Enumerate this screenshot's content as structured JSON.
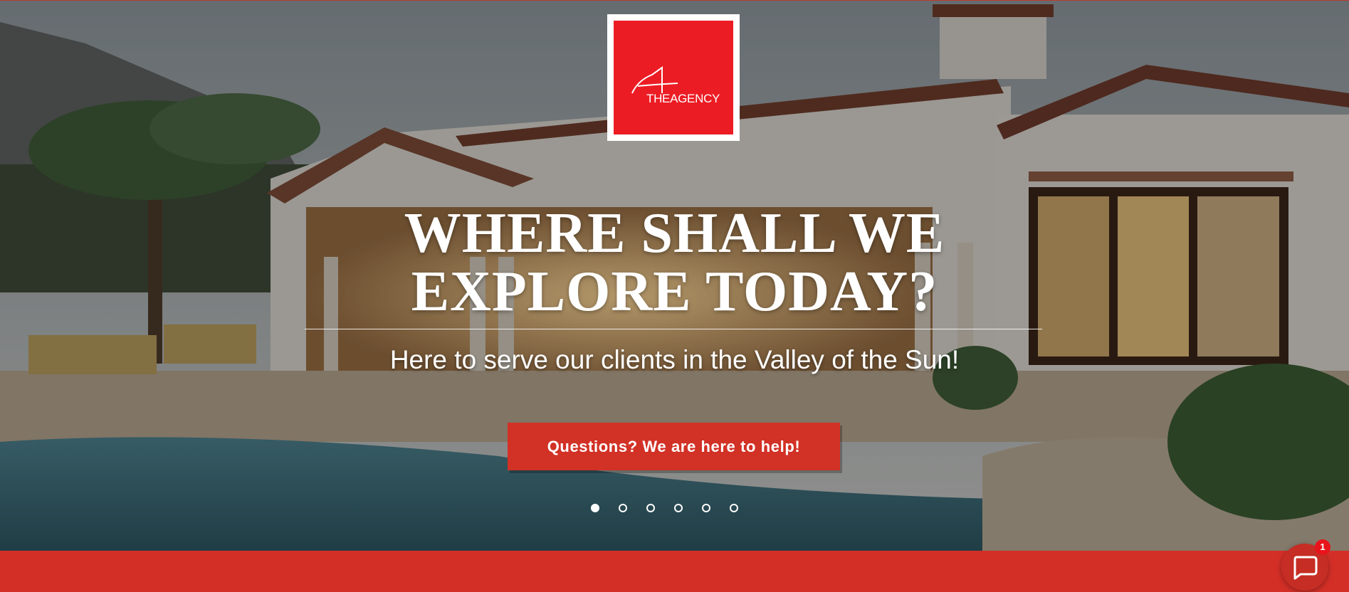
{
  "logo": {
    "text": "THEAGENCY",
    "brand_color": "#ec1c24"
  },
  "hero": {
    "headline_line1": "WHERE SHALL WE",
    "headline_line2": "EXPLORE TODAY?",
    "subheadline": "Here to serve our clients in the Valley of the Sun!",
    "cta_label": "Questions? We are here to help!",
    "cta_color": "#d23126"
  },
  "carousel": {
    "slide_count": 6,
    "active_index": 0
  },
  "chat": {
    "icon": "chat-bubble-icon",
    "badge_count": "1"
  },
  "footer_bar": {
    "color": "#d42f27"
  }
}
